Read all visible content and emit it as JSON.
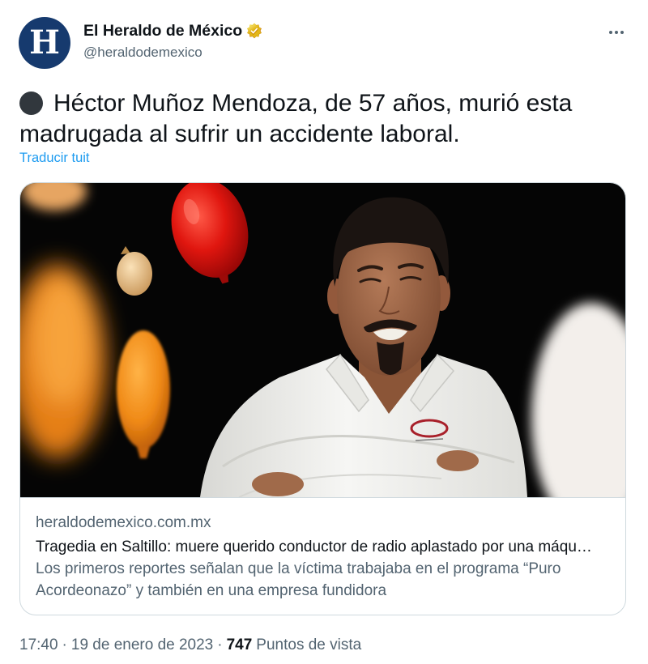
{
  "author": {
    "name": "El Heraldo de México",
    "handle": "@heraldodemexico",
    "avatar_letter": "H",
    "verified_icon": "gold-verified-badge-icon"
  },
  "header": {
    "more_icon": "more-options-icon"
  },
  "tweet": {
    "lead_emoji_icon": "black-circle-emoji",
    "text": "Héctor Muñoz Mendoza, de 57 años, murió esta madrugada al sufrir un accidente laboral.",
    "translate_label": "Traducir tuit"
  },
  "card": {
    "domain": "heraldodemexico.com.mx",
    "title": "Tragedia en Saltillo: muere querido conductor de radio aplastado por una máqu…",
    "description": "Los primeros reportes señalan que la víctima trabajaba en el programa “Puro Acordeonazo” y también en una empresa fundidora"
  },
  "meta": {
    "time": "17:40",
    "separator": "·",
    "date": "19 de enero de 2023",
    "views_count": "747",
    "views_label": "Puntos de vista"
  },
  "colors": {
    "text_primary": "#0f1419",
    "text_secondary": "#536471",
    "link": "#1d9bf0",
    "border": "#cfd9de",
    "avatar_bg": "#163a6e",
    "emoji": "#31373d"
  }
}
